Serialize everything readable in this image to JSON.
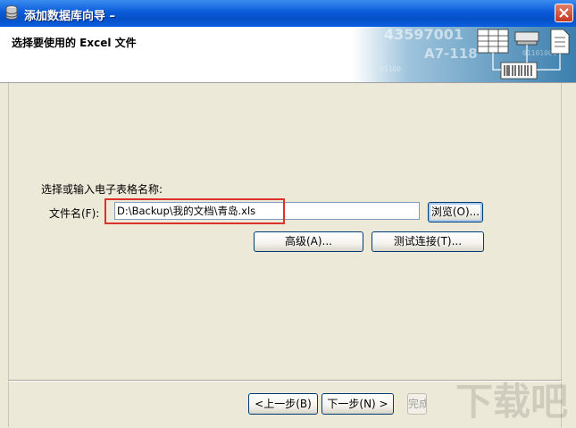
{
  "window": {
    "title": "添加数据库向导 –"
  },
  "header": {
    "title": "选择要使用的 Excel 文件",
    "banner_numbers": [
      "43597001",
      "A7-118",
      "01101001",
      "01100"
    ]
  },
  "form": {
    "prompt": "选择或输入电子表格名称:",
    "file_label": "文件名(F):",
    "file_value": "D:\\Backup\\我的文档\\青岛.xls",
    "browse_label": "浏览(O)...",
    "advanced_label": "高级(A)...",
    "test_label": "测试连接(T)..."
  },
  "footer": {
    "prev_label": "<上一步(B)",
    "next_label": "下一步(N) >",
    "finish_label": "完成"
  },
  "watermark": {
    "text": "下载吧"
  },
  "colors": {
    "titlebar": "#0a5bd8",
    "highlight": "#e0302c",
    "dialog_bg": "#ece9d8"
  }
}
